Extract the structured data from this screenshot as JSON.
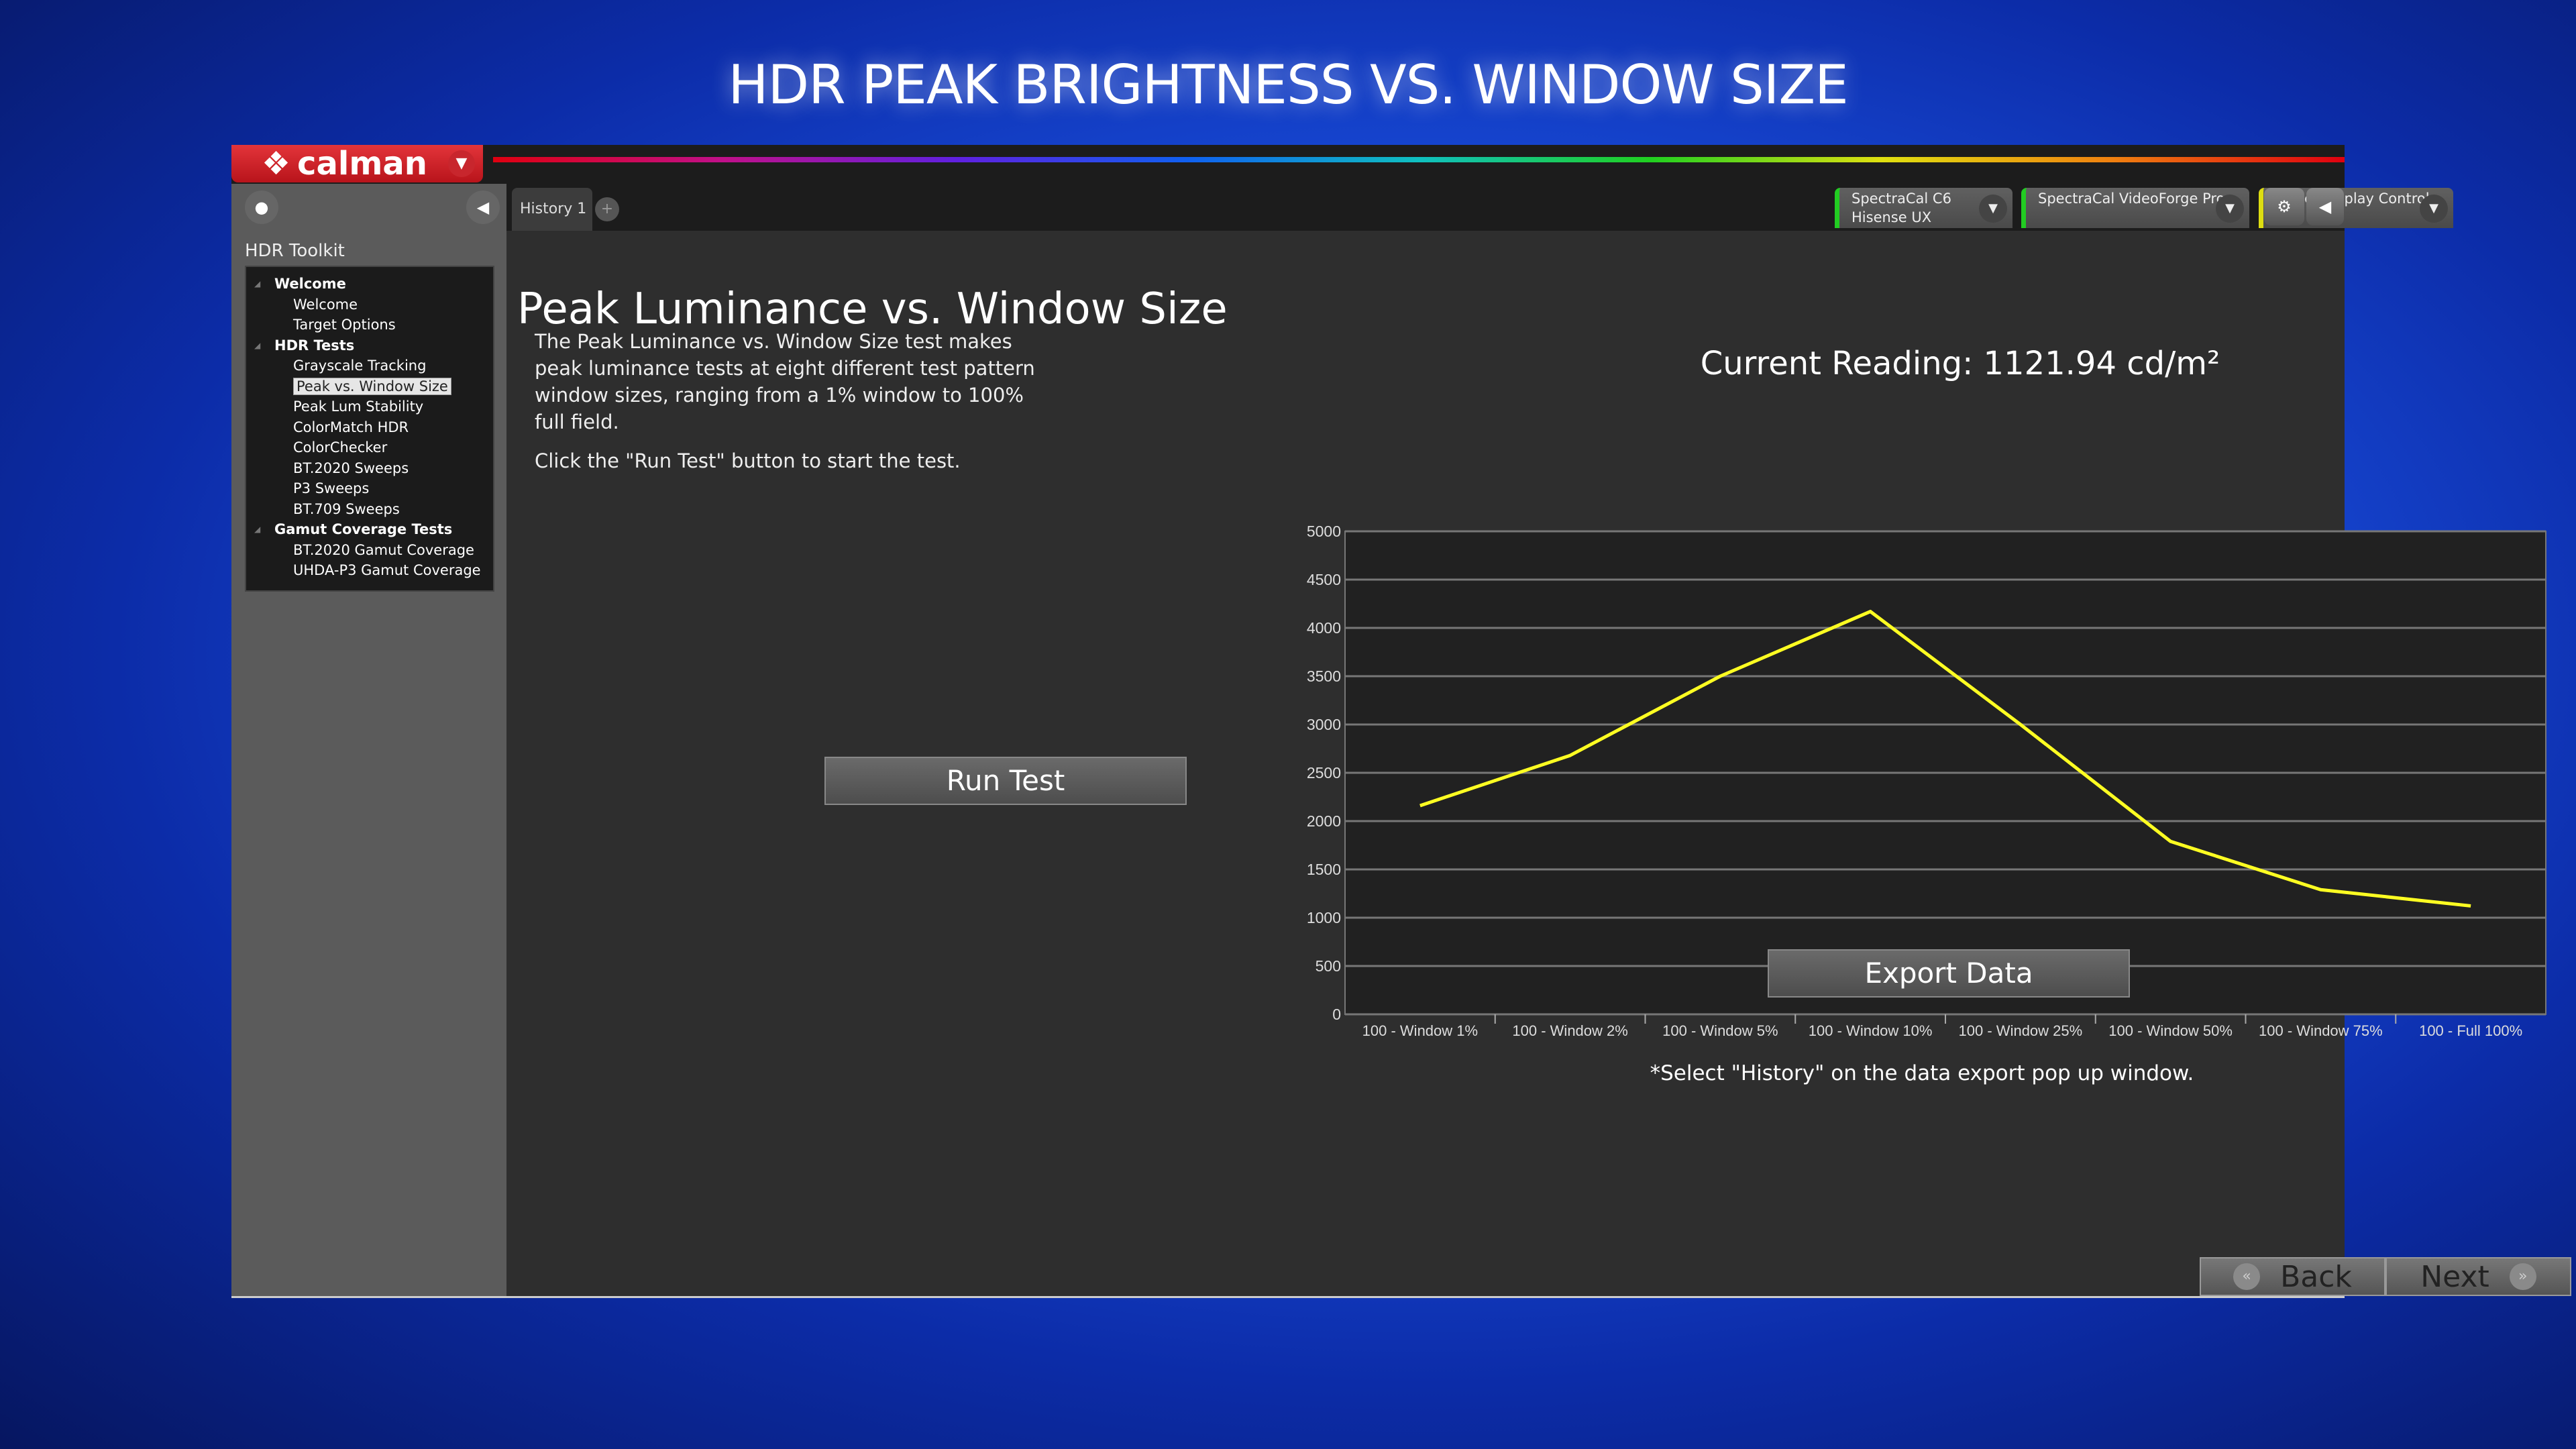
{
  "page_title": "HDR PEAK BRIGHTNESS VS. WINDOW SIZE",
  "app": {
    "logo": "calman"
  },
  "sidebar": {
    "title": "HDR Toolkit",
    "tree": [
      {
        "label": "Welcome",
        "type": "group"
      },
      {
        "label": "Welcome",
        "type": "item"
      },
      {
        "label": "Target Options",
        "type": "item"
      },
      {
        "label": "HDR Tests",
        "type": "group"
      },
      {
        "label": "Grayscale Tracking",
        "type": "item"
      },
      {
        "label": "Peak vs. Window Size",
        "type": "item",
        "selected": true
      },
      {
        "label": "Peak Lum Stability",
        "type": "item"
      },
      {
        "label": "ColorMatch HDR",
        "type": "item"
      },
      {
        "label": "ColorChecker",
        "type": "item"
      },
      {
        "label": "BT.2020 Sweeps",
        "type": "item"
      },
      {
        "label": "P3 Sweeps",
        "type": "item"
      },
      {
        "label": "BT.709 Sweeps",
        "type": "item"
      },
      {
        "label": "Gamut Coverage Tests",
        "type": "group"
      },
      {
        "label": "BT.2020 Gamut Coverage",
        "type": "item"
      },
      {
        "label": "UHDA-P3 Gamut Coverage",
        "type": "item"
      }
    ]
  },
  "tabs": {
    "history": "History 1",
    "add": "+"
  },
  "devices": [
    {
      "line1": "SpectraCal C6",
      "line2": "Hisense UX",
      "status_color": "#22cc22"
    },
    {
      "line1": "SpectraCal VideoForge Pro",
      "line2": "",
      "status_color": "#22cc22"
    },
    {
      "line1": "Direct Display Control",
      "line2": "",
      "status_color": "#dddd11"
    }
  ],
  "main": {
    "heading": "Peak Luminance vs. Window Size",
    "desc1": "The Peak Luminance vs. Window Size test makes peak luminance tests at eight different test pattern window sizes, ranging from a 1% window to 100% full field.",
    "desc2": "Click the \"Run Test\" button to start the test.",
    "run_button": "Run Test",
    "current_reading": "Current Reading: 1121.94 cd/m²",
    "export_button": "Export  Data",
    "footnote": "*Select \"History\" on the data export pop up window."
  },
  "nav": {
    "back": "Back",
    "next": "Next"
  },
  "chart_data": {
    "type": "line",
    "categories": [
      "100 - Window  1%",
      "100 - Window  2%",
      "100 - Window  5%",
      "100 - Window 10%",
      "100 - Window 25%",
      "100 - Window 50%",
      "100 - Window 75%",
      "100 - Full  100%"
    ],
    "values": [
      2160,
      2680,
      3500,
      4170,
      3000,
      1790,
      1290,
      1122
    ],
    "ylim": [
      0,
      5000
    ],
    "yticks": [
      0,
      500,
      1000,
      1500,
      2000,
      2500,
      3000,
      3500,
      4000,
      4500,
      5000
    ],
    "grid": true,
    "line_color": "#ffff22"
  }
}
